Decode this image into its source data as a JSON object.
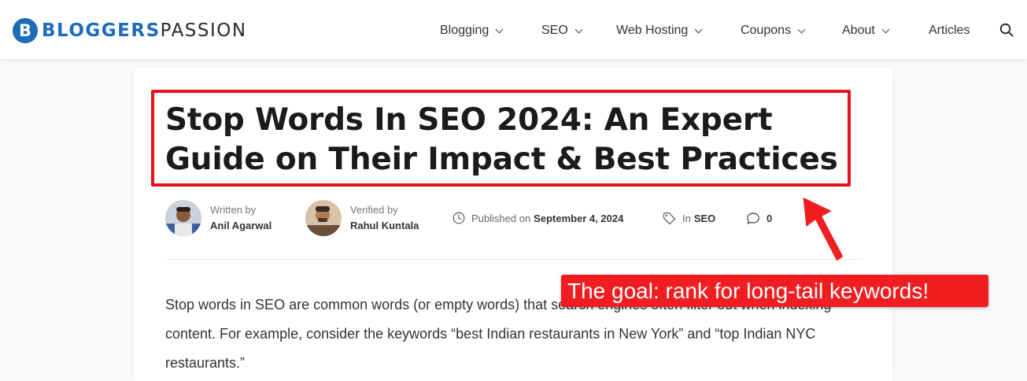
{
  "logo": {
    "mark": "B",
    "text_bold": "BLOGGERS",
    "text_regular": "PASSION"
  },
  "nav": {
    "items": [
      {
        "label": "Blogging",
        "dropdown": true
      },
      {
        "label": "SEO",
        "dropdown": true
      },
      {
        "label": "Web Hosting",
        "dropdown": true
      },
      {
        "label": "Coupons",
        "dropdown": true
      },
      {
        "label": "About",
        "dropdown": true
      },
      {
        "label": "Articles",
        "dropdown": false
      }
    ],
    "search_icon": "search-icon"
  },
  "article": {
    "title": "Stop Words In SEO 2024: An Expert Guide on Their Impact & Best Practices",
    "author": {
      "label": "Written by",
      "name": "Anil Agarwal"
    },
    "verifier": {
      "label": "Verified by",
      "name": "Rahul Kuntala"
    },
    "published": {
      "label": "Published on",
      "date": "September 4, 2024"
    },
    "category": {
      "label": "In",
      "name": "SEO"
    },
    "comments": "0",
    "intro": "Stop words in SEO are common words (or empty words) that search engines often filter out when indexing content. For example, consider the keywords “best Indian restaurants in New York” and “top Indian NYC restaurants.”"
  },
  "annotation": {
    "callout": "The goal: rank for long-tail keywords!",
    "box_color": "#e8141b",
    "callout_color": "#f01e21"
  },
  "colors": {
    "brand": "#1e6bb8"
  }
}
